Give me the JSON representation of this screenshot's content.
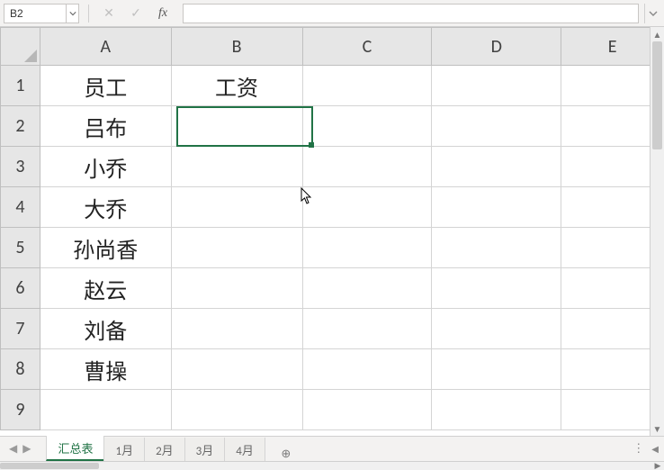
{
  "formula_bar": {
    "name_box": "B2",
    "cancel_icon": "✕",
    "enter_icon": "✓",
    "fx_label": "fx",
    "formula_value": ""
  },
  "columns": [
    "A",
    "B",
    "C",
    "D",
    "E"
  ],
  "rows": [
    "1",
    "2",
    "3",
    "4",
    "5",
    "6",
    "7",
    "8",
    "9"
  ],
  "cells": {
    "A1": "员工",
    "B1": "工资",
    "A2": "吕布",
    "A3": "小乔",
    "A4": "大乔",
    "A5": "孙尚香",
    "A6": "赵云",
    "A7": "刘备",
    "A8": "曹操"
  },
  "active_cell": "B2",
  "tabs": {
    "items": [
      {
        "label": "汇总表",
        "active": true
      },
      {
        "label": "1月",
        "active": false
      },
      {
        "label": "2月",
        "active": false
      },
      {
        "label": "3月",
        "active": false
      },
      {
        "label": "4月",
        "active": false
      }
    ],
    "add_icon": "⊕"
  }
}
